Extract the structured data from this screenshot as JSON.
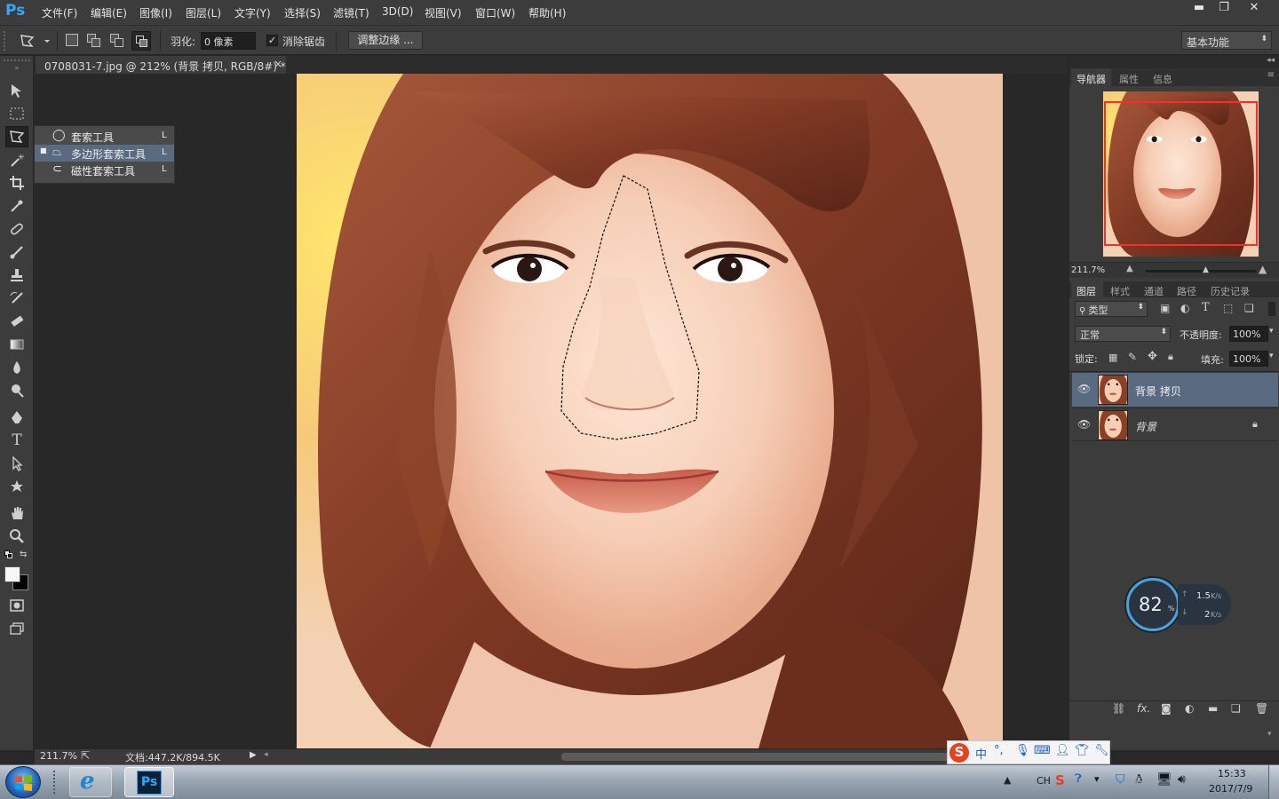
{
  "app": {
    "logo": "Ps"
  },
  "menu": [
    "文件(F)",
    "编辑(E)",
    "图像(I)",
    "图层(L)",
    "文字(Y)",
    "选择(S)",
    "滤镜(T)",
    "3D(D)",
    "视图(V)",
    "窗口(W)",
    "帮助(H)"
  ],
  "window_controls": {
    "minimize": "▬",
    "restore": "❐",
    "close": "✕"
  },
  "options": {
    "feather_label": "羽化:",
    "feather_value": "0 像素",
    "antialias_label": "消除锯齿",
    "antialias_checked": true,
    "refine_edge_label": "调整边缘 ...",
    "workspace": "基本功能"
  },
  "document": {
    "tab_title": "0708031-7.jpg @ 212% (背景 拷贝, RGB/8#) *",
    "close": "×",
    "zoom": "211.7%",
    "doc_info": "文档:447.2K/894.5K"
  },
  "flyout": {
    "items": [
      {
        "label": "套索工具",
        "shortcut": "L",
        "selected": false
      },
      {
        "label": "多边形套索工具",
        "shortcut": "L",
        "selected": true
      },
      {
        "label": "磁性套索工具",
        "shortcut": "L",
        "selected": false
      }
    ]
  },
  "navigator": {
    "tabs": [
      "导航器",
      "属性",
      "信息"
    ],
    "zoom": "211.7%"
  },
  "layers_panel": {
    "tabs": [
      "图层",
      "样式",
      "通道",
      "路径",
      "历史记录"
    ],
    "filter_kind": "类型",
    "blend_mode": "正常",
    "opacity_label": "不透明度:",
    "opacity": "100%",
    "lock_label": "锁定:",
    "fill_label": "填充:",
    "fill": "100%",
    "layers": [
      {
        "name": "背景 拷贝",
        "selected": true,
        "locked": false
      },
      {
        "name": "背景",
        "selected": false,
        "locked": true
      }
    ]
  },
  "speed_widget": {
    "percent": "82",
    "unit": "%",
    "upload": "1.5",
    "upload_unit": "K/s",
    "download": "2",
    "download_unit": "K/s"
  },
  "ime_bar": {
    "label": "中"
  },
  "taskbar": {
    "lang": "CH",
    "time": "15:33",
    "date": "2017/7/9"
  },
  "colors": {
    "accent_blue": "#31a8ff",
    "selected_layer": "#5a6a80",
    "panel_bg": "#3c3c3c",
    "nav_frame": "#ff2a2a"
  }
}
